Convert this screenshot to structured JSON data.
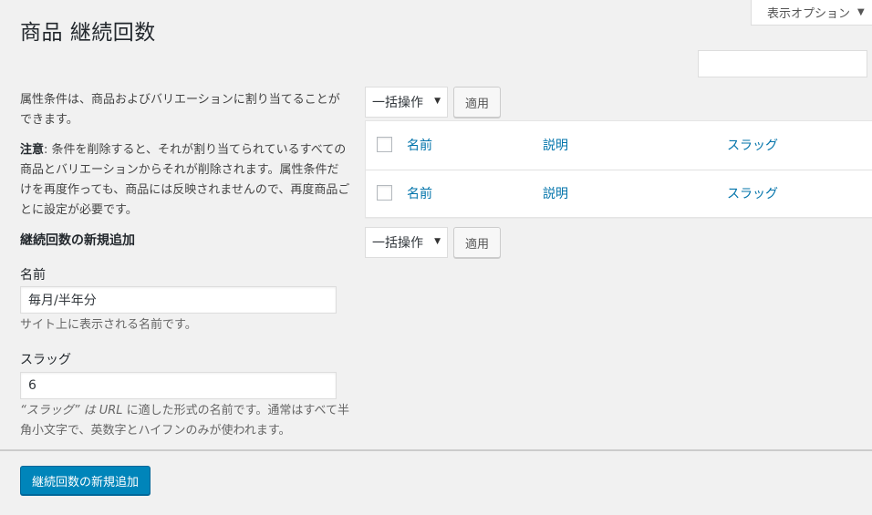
{
  "screen_options": {
    "label": "表示オプション",
    "caret": "▼"
  },
  "page": {
    "title": "商品 継続回数"
  },
  "search": {
    "value": ""
  },
  "left": {
    "intro": "属性条件は、商品およびバリエーションに割り当てることができます。",
    "note_label": "注意",
    "note_text": ": 条件を削除すると、それが割り当てられているすべての商品とバリエーションからそれが削除されます。属性条件だけを再度作っても、商品には反映されませんので、再度商品ごとに設定が必要です。",
    "section_title": "継続回数の新規追加",
    "name_label": "名前",
    "name_value": "毎月/半年分",
    "name_help": "サイト上に表示される名前です。",
    "slug_label": "スラッグ",
    "slug_value": "6",
    "slug_help_1": "“スラッグ” は ",
    "slug_help_url": "URL",
    "slug_help_2": " に適した形式の名前です。通常はすべて半角小文字で、英数字とハイフンのみが使われます。",
    "submit_label": "継続回数の新規追加"
  },
  "bulk_top": {
    "select": "一括操作",
    "apply": "適用"
  },
  "bulk_bottom": {
    "select": "一括操作",
    "apply": "適用"
  },
  "table": {
    "columns": [
      "名前",
      "説明",
      "スラッグ"
    ]
  }
}
